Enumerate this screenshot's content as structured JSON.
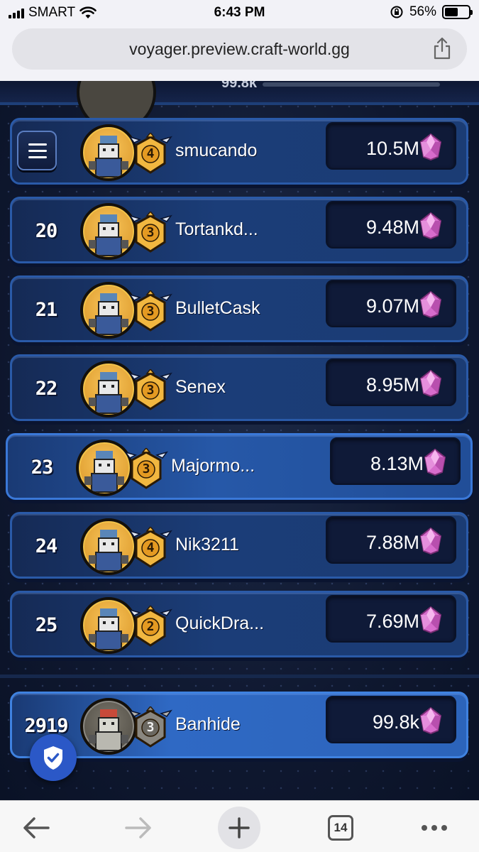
{
  "status_bar": {
    "carrier": "SMART",
    "time": "6:43 PM",
    "battery_percent": "56%",
    "battery_level": 0.56
  },
  "browser": {
    "url": "voyager.preview.craft-world.gg",
    "tab_count": "14"
  },
  "leaderboard": {
    "top_partial_score": "99.8k",
    "rows": [
      {
        "rank": "",
        "name": "smucando",
        "level": "4",
        "score": "10.5M"
      },
      {
        "rank": "20",
        "name": "Tortankd...",
        "level": "3",
        "score": "9.48M"
      },
      {
        "rank": "21",
        "name": "BulletCask",
        "level": "3",
        "score": "9.07M"
      },
      {
        "rank": "22",
        "name": "Senex",
        "level": "3",
        "score": "8.95M"
      },
      {
        "rank": "23",
        "name": "Majormo...",
        "level": "3",
        "score": "8.13M"
      },
      {
        "rank": "24",
        "name": "Nik3211",
        "level": "4",
        "score": "7.88M"
      },
      {
        "rank": "25",
        "name": "QuickDra...",
        "level": "2",
        "score": "7.69M"
      }
    ],
    "me": {
      "rank": "2919",
      "name": "Banhide",
      "level": "3",
      "score": "99.8k"
    }
  },
  "icons": {
    "currency": "pink-gem-icon",
    "menu": "hamburger-menu-icon",
    "shield": "shield-check-icon"
  },
  "colors": {
    "gem": "#e57fd6",
    "gold_badge": "#f1b740",
    "row_blue": "#1b3d78",
    "shield_button": "#2b58c7"
  }
}
